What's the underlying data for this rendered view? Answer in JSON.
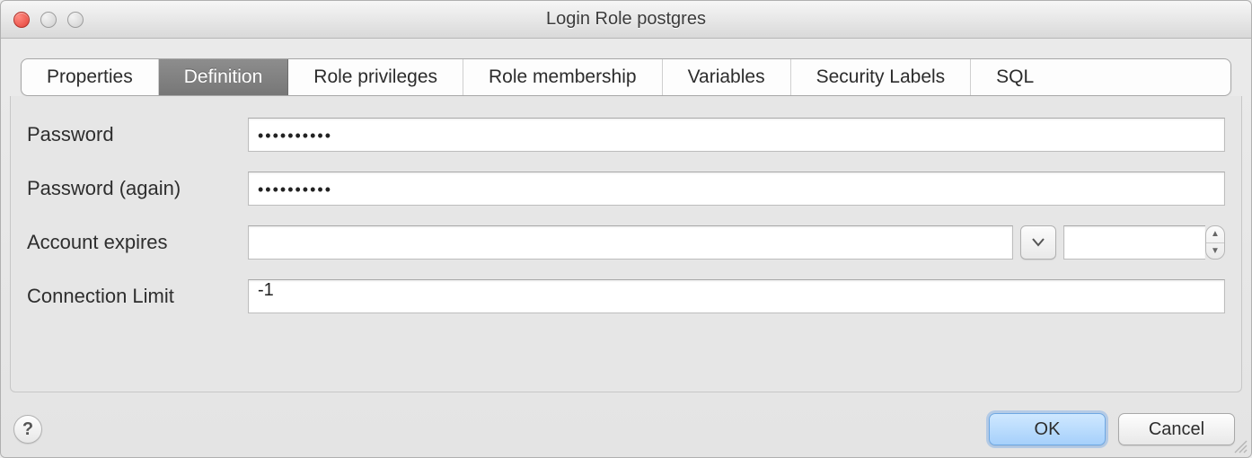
{
  "window": {
    "title": "Login Role postgres"
  },
  "tabs": [
    {
      "label": "Properties",
      "active": false
    },
    {
      "label": "Definition",
      "active": true
    },
    {
      "label": "Role privileges",
      "active": false
    },
    {
      "label": "Role membership",
      "active": false
    },
    {
      "label": "Variables",
      "active": false
    },
    {
      "label": "Security Labels",
      "active": false
    },
    {
      "label": "SQL",
      "active": false
    }
  ],
  "form": {
    "password_label": "Password",
    "password_value": "••••••••••",
    "password_again_label": "Password (again)",
    "password_again_value": "••••••••••",
    "account_expires_label": "Account expires",
    "account_expires_value": "",
    "account_expires_spin_value": "",
    "connection_limit_label": "Connection Limit",
    "connection_limit_value": "-1"
  },
  "buttons": {
    "ok": "OK",
    "cancel": "Cancel",
    "help": "?"
  }
}
